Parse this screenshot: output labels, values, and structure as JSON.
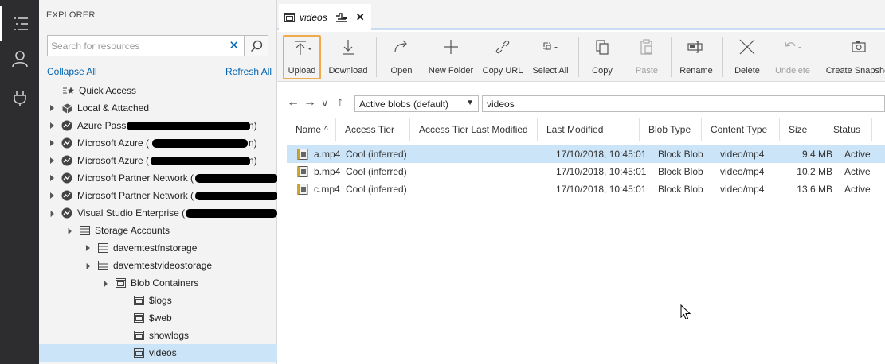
{
  "activity_bar": {
    "items": [
      {
        "icon": "explorer-list-icon"
      },
      {
        "icon": "account-icon"
      },
      {
        "icon": "plug-icon"
      }
    ]
  },
  "explorer": {
    "title": "EXPLORER",
    "search_placeholder": "Search for resources",
    "collapse_all": "Collapse All",
    "refresh_all": "Refresh All",
    "tree": [
      {
        "label": "Quick Access",
        "icon": "quick-access-icon"
      },
      {
        "label": "Local & Attached",
        "icon": "cube-icon"
      },
      {
        "label": "Azure Pass",
        "icon": "subscription-icon"
      },
      {
        "label": "Microsoft Azure (",
        "icon": "subscription-icon"
      },
      {
        "label": "Microsoft Azure (",
        "icon": "subscription-icon"
      },
      {
        "label": "Microsoft Partner Network (",
        "icon": "subscription-icon"
      },
      {
        "label": "Microsoft Partner Network (",
        "icon": "subscription-icon"
      },
      {
        "label": "Visual Studio Enterprise (",
        "icon": "subscription-icon"
      },
      {
        "label": "Storage Accounts",
        "icon": "storage-icon"
      },
      {
        "label": "davemtestfnstorage",
        "icon": "storage-icon"
      },
      {
        "label": "davemtestvideostorage",
        "icon": "storage-icon"
      },
      {
        "label": "Blob Containers",
        "icon": "container-icon"
      },
      {
        "label": "$logs",
        "icon": "container-icon"
      },
      {
        "label": "$web",
        "icon": "container-icon"
      },
      {
        "label": "showlogs",
        "icon": "container-icon"
      },
      {
        "label": "videos",
        "icon": "container-icon"
      }
    ],
    "tree_suffixes": {
      "azure_pass": "n)",
      "azure_1": "n)",
      "azure_2": "n)"
    }
  },
  "tab": {
    "title": "videos"
  },
  "toolbar": {
    "buttons": [
      {
        "label": "Upload",
        "icon": "upload-icon"
      },
      {
        "label": "Download",
        "icon": "download-icon"
      },
      {
        "label": "Open",
        "icon": "open-icon"
      },
      {
        "label": "New Folder",
        "icon": "plus-icon"
      },
      {
        "label": "Copy URL",
        "icon": "link-icon"
      },
      {
        "label": "Select All",
        "icon": "select-all-icon"
      },
      {
        "label": "Copy",
        "icon": "copy-icon"
      },
      {
        "label": "Paste",
        "icon": "paste-icon"
      },
      {
        "label": "Rename",
        "icon": "rename-icon"
      },
      {
        "label": "Delete",
        "icon": "delete-icon"
      },
      {
        "label": "Undelete",
        "icon": "undelete-icon"
      },
      {
        "label": "Create Snapshot",
        "icon": "camera-icon"
      }
    ]
  },
  "nav": {
    "filter_selected": "Active blobs (default)",
    "path": "videos"
  },
  "table": {
    "columns": [
      "Name",
      "Access Tier",
      "Access Tier Last Modified",
      "Last Modified",
      "Blob Type",
      "Content Type",
      "Size",
      "Status"
    ],
    "rows": [
      {
        "name": "a.mp4",
        "tier": "Cool (inferred)",
        "tier_modified": "",
        "modified": "17/10/2018, 10:45:01",
        "type": "Block Blob",
        "content_type": "video/mp4",
        "size": "9.4 MB",
        "status": "Active"
      },
      {
        "name": "b.mp4",
        "tier": "Cool (inferred)",
        "tier_modified": "",
        "modified": "17/10/2018, 10:45:01",
        "type": "Block Blob",
        "content_type": "video/mp4",
        "size": "10.2 MB",
        "status": "Active"
      },
      {
        "name": "c.mp4",
        "tier": "Cool (inferred)",
        "tier_modified": "",
        "modified": "17/10/2018, 10:45:01",
        "type": "Block Blob",
        "content_type": "video/mp4",
        "size": "13.6 MB",
        "status": "Active"
      }
    ]
  },
  "colors": {
    "activity_bar": "#2d2d30",
    "selection": "#cce4f7",
    "link": "#0063b1",
    "focus_outline": "#f0a94d"
  }
}
